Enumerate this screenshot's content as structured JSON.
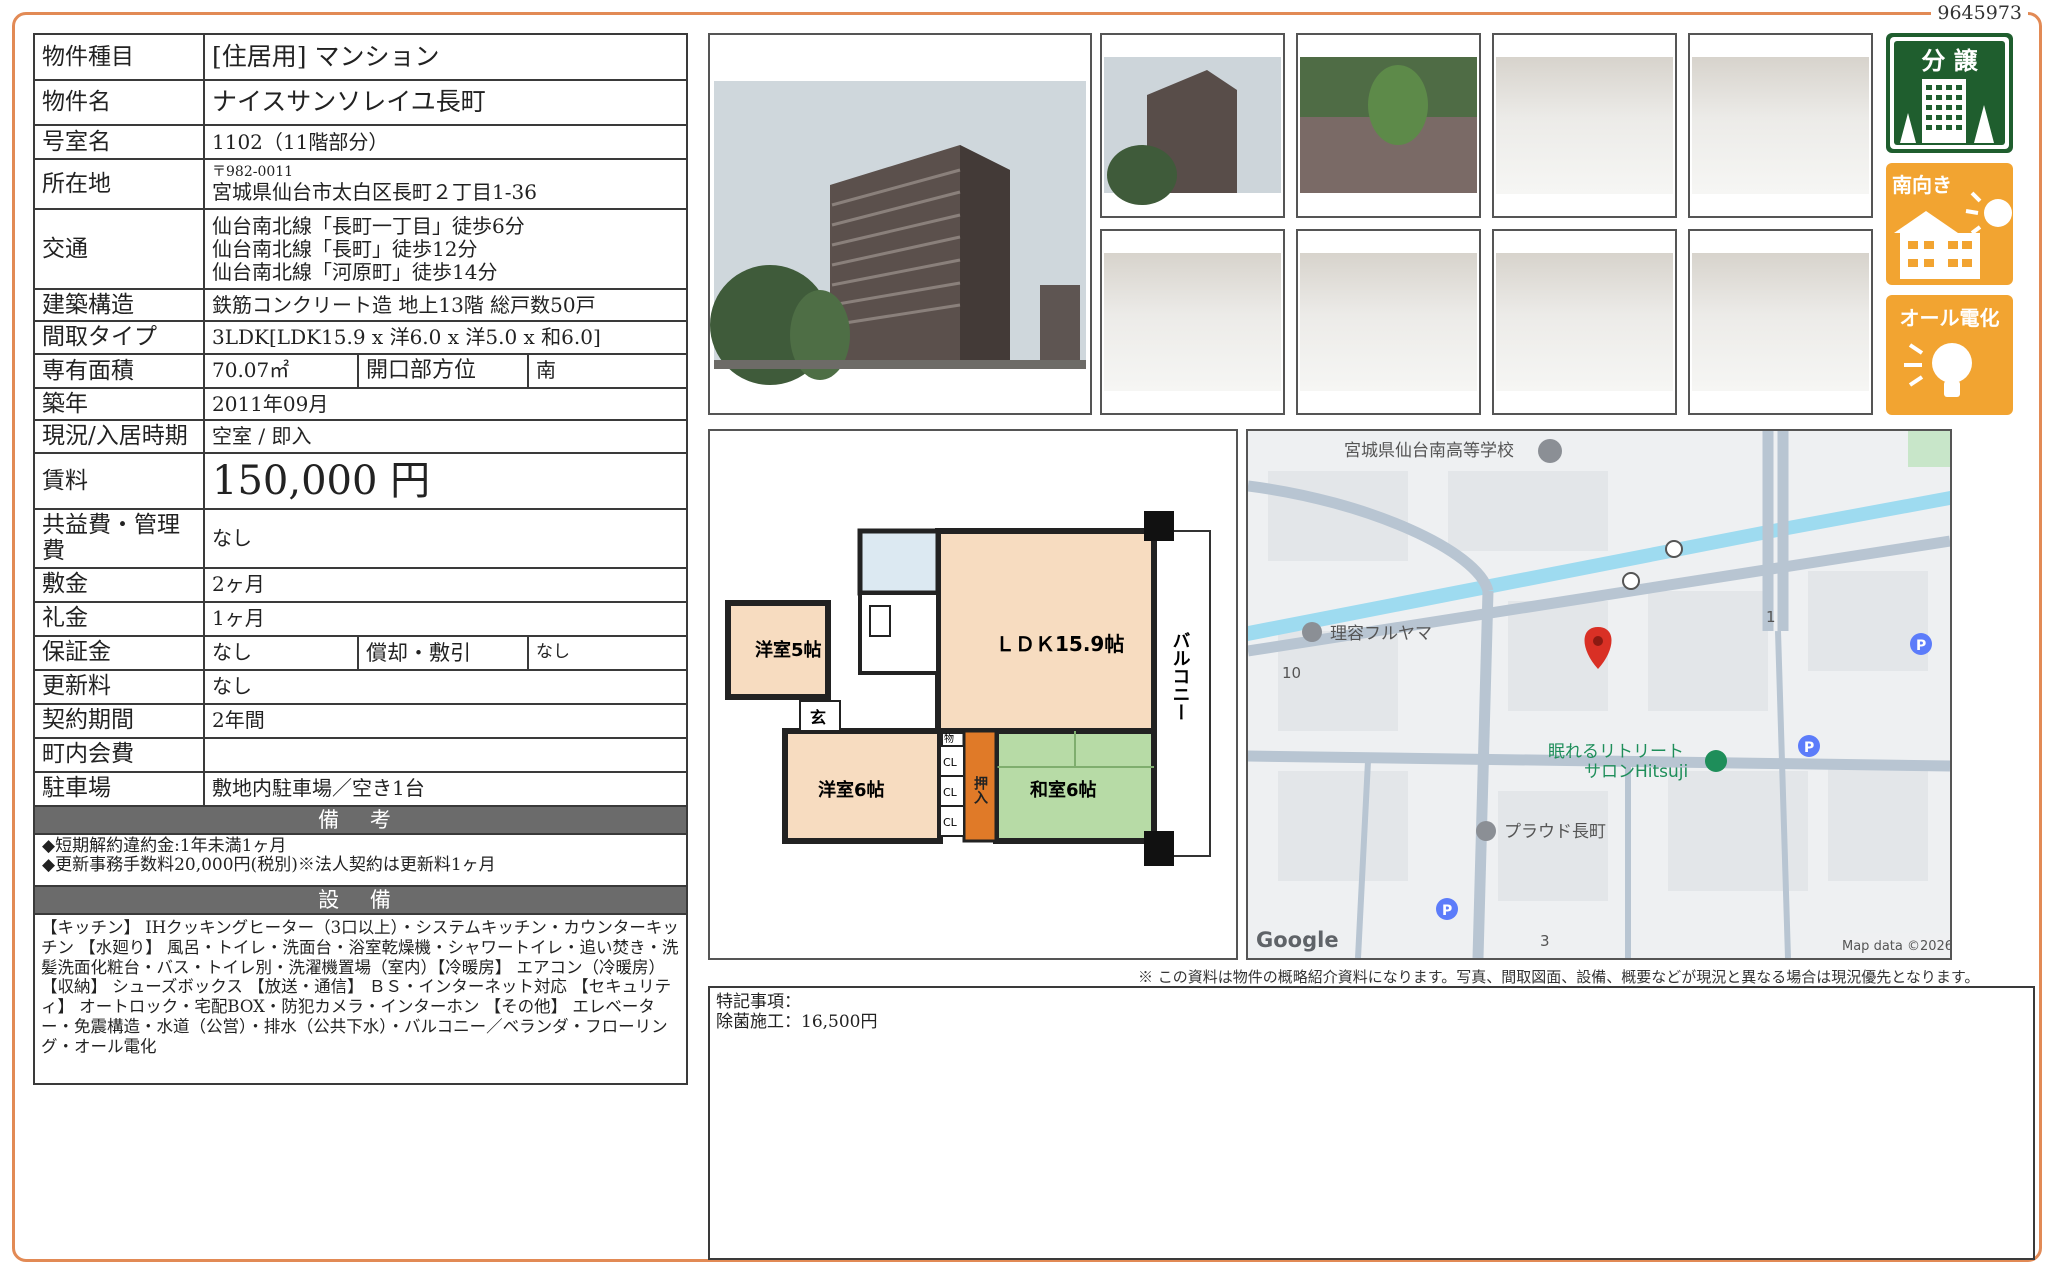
{
  "doc_id": "9645973",
  "property": {
    "type_label": "物件種目",
    "type_value": "[住居用] マンション",
    "name_label": "物件名",
    "name_value": "ナイスサンソレイユ長町",
    "room_label": "号室名",
    "room_value": "1102（11階部分）",
    "address_label": "所在地",
    "postal": "〒982-0011",
    "address": "宮城県仙台市太白区長町２丁目1-36",
    "access_label": "交通",
    "access": [
      "仙台南北線「長町一丁目」徒歩6分",
      "仙台南北線「長町」徒歩12分",
      "仙台南北線「河原町」徒歩14分"
    ],
    "structure_label": "建築構造",
    "structure_value": "鉄筋コンクリート造 地上13階 総戸数50戸",
    "layout_label": "間取タイプ",
    "layout_value": "3LDK[LDK15.9 x 洋6.0 x 洋5.0 x 和6.0]",
    "area_label": "専有面積",
    "area_value": "70.07㎡",
    "direction_label": "開口部方位",
    "direction_value": "南",
    "built_label": "築年",
    "built_value": "2011年09月",
    "status_label": "現況/入居時期",
    "status_value": "空室 / 即入",
    "rent_label": "賃料",
    "rent_value": "150,000 円",
    "fee_label": "共益費・管理費",
    "fee_value": "なし",
    "deposit_label": "敷金",
    "deposit_value": "2ヶ月",
    "key_money_label": "礼金",
    "key_money_value": "1ヶ月",
    "guarantee_label": "保証金",
    "guarantee_value": "なし",
    "amort_label": "償却・敷引",
    "amort_value": "なし",
    "renewal_label": "更新料",
    "renewal_value": "なし",
    "contract_label": "契約期間",
    "contract_value": "2年間",
    "assoc_label": "町内会費",
    "assoc_value": "",
    "parking_label": "駐車場",
    "parking_value": "敷地内駐車場／空き1台",
    "remarks_label": "備 考",
    "remarks": [
      "◆短期解約違約金:1年未満1ヶ月",
      "◆更新事務手数料20,000円(税別)※法人契約は更新料1ヶ月"
    ],
    "equipment_label": "設 備",
    "equipment": "【キッチン】 IHクッキングヒーター（3口以上）・システムキッチン・カウンターキッチン 【水廻り】 風呂・トイレ・洗面台・浴室乾燥機・シャワートイレ・追い焚き・洗髪洗面化粧台・バス・トイレ別・洗濯機置場（室内）【冷暖房】 エアコン（冷暖房）【収納】 シューズボックス 【放送・通信】 ＢＳ・インターネット対応 【セキュリティ】 オートロック・宅配BOX・防犯カメラ・インターホン 【その他】 エレベーター・免震構造・水道（公営）・排水（公共下水）・バルコニー／ベランダ・フローリング・オール電化"
  },
  "badges": {
    "bunjo": "分 譲",
    "south": "南向き",
    "electric": "オール電化"
  },
  "floorplan": {
    "room1": "洋室5帖",
    "room2": "洋室6帖",
    "ldk": "ＬＤＫ15.9帖",
    "washitsu": "和室6帖",
    "balcony": "バルコニー",
    "entrance": "玄",
    "closet": "押入",
    "cl": "CL",
    "storage": "物"
  },
  "map": {
    "school": "宮城県仙台南高等学校",
    "barber": "理容フルヤマ",
    "salon1": "眠れるリトリート",
    "salon2": "サロンHitsuji",
    "proud": "プラウド長町",
    "num1": "1",
    "num10": "10",
    "num3": "3",
    "parking": "P",
    "google": "Google",
    "credit": "Map data ©2026"
  },
  "disclaimer": "※ この資料は物件の概略紹介資料になります。写真、間取図面、設備、概要などが現況と異なる場合は現況優先となります。",
  "special_notes": {
    "title": "特記事項：",
    "line1": "除菌施工：16,500円"
  },
  "colors": {
    "frame": "#e28a55",
    "bunjo_green": "#1f5e2e",
    "badge_orange": "#f2a431",
    "tatami": "#b7dba6",
    "wood": "#f7dcc0",
    "closet": "#e07a28",
    "map_water": "#9edbf0",
    "map_road": "#b8c5d2",
    "pin": "#d93025"
  }
}
